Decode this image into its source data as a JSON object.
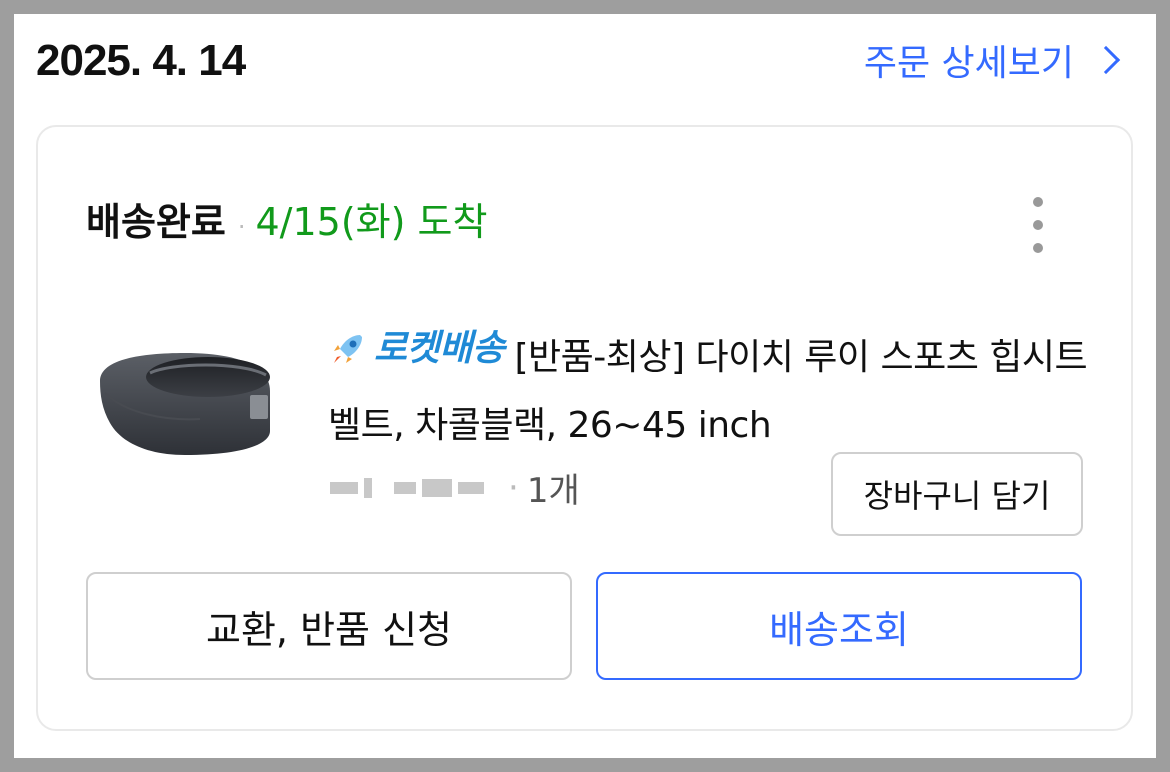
{
  "header": {
    "date": "2025. 4. 14",
    "order_detail_label": "주문 상세보기"
  },
  "delivery": {
    "status": "배송완료",
    "separator": "·",
    "arrival": "4/15(화) 도착"
  },
  "product": {
    "badge": "로켓배송",
    "title": "[반품-최상] 다이치 루이 스포츠 힙시트벨트, 차콜블랙, 26~45 inch",
    "separator": "·",
    "quantity": "1개"
  },
  "buttons": {
    "add_to_cart": "장바구니 담기",
    "exchange_return": "교환, 반품 신청",
    "track_delivery": "배송조회"
  },
  "colors": {
    "accent": "#346aff",
    "arrival": "#119a1b",
    "rocket": "#1f8ad6"
  }
}
